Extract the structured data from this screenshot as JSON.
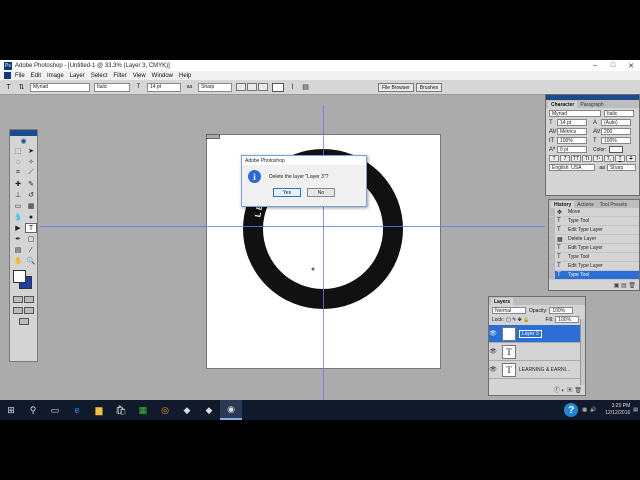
{
  "window": {
    "title": "Adobe Photoshop - [Untitled-1 @ 33.3% (Layer 3, CMYK)]",
    "app_icon": "Ps"
  },
  "menu": [
    "File",
    "Edit",
    "Image",
    "Layer",
    "Select",
    "Filter",
    "View",
    "Window",
    "Help"
  ],
  "options_bar": {
    "font_family": "Myriad",
    "font_style": "Italic",
    "font_size": "14 pt",
    "antialias": "Sharp"
  },
  "palette_well": [
    "File Browser",
    "Brushes"
  ],
  "canvas": {
    "ring_text": "LEARNING & EARNING"
  },
  "dialog": {
    "title": "Adobe Photoshop",
    "message": "Delete the layer \"Layer 3\"?",
    "yes_label": "Yes",
    "no_label": "No"
  },
  "character_panel": {
    "tabs": [
      "Character",
      "Paragraph"
    ],
    "font_family": "Myriad",
    "font_style": "Italic",
    "font_size": "14 pt",
    "leading": "(Auto)",
    "tracking": "Metrics",
    "kerning": "200",
    "vscale": "100%",
    "hscale": "100%",
    "baseline": "0 pt",
    "color_label": "Color:",
    "language": "English: USA",
    "antialias": "Sharp"
  },
  "history_panel": {
    "tabs": [
      "History",
      "Actions",
      "Tool Presets"
    ],
    "items": [
      "Move",
      "Type Tool",
      "Edit Type Layer",
      "Delete Layer",
      "Edit Type Layer",
      "Type Tool",
      "Edit Type Layer",
      "Type Tool"
    ],
    "selected_index": 7
  },
  "layers_panel": {
    "tabs": [
      "Layers"
    ],
    "blend_mode": "Normal",
    "opacity_label": "Opacity:",
    "opacity": "100%",
    "lock_label": "Lock:",
    "fill_label": "Fill:",
    "fill": "100%",
    "layers": [
      {
        "name": "Layer 3",
        "thumb": "T",
        "selected": true
      },
      {
        "name": "",
        "thumb": "T",
        "selected": false
      },
      {
        "name": "LEARNING & EARNI...",
        "thumb": "T",
        "selected": false
      }
    ]
  },
  "taskbar": {
    "time": "3:20 PM",
    "date": "12/12/2016"
  },
  "colors": {
    "accent": "#2b6fd6",
    "guide": "#5a7ff0",
    "panel_bg": "#d4d4d4",
    "workspace": "#ababab"
  }
}
